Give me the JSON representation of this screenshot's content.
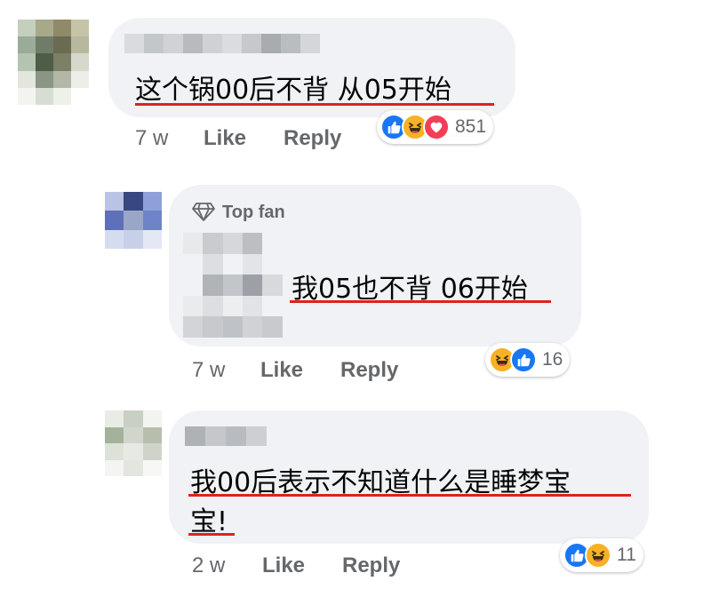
{
  "comments": [
    {
      "text": "这个锅00后不背 从05开始",
      "time": "7 w",
      "like_label": "Like",
      "reply_label": "Reply",
      "reaction_count": "851",
      "reactions": [
        "like-icon",
        "haha-icon",
        "love-icon"
      ]
    },
    {
      "badge": "Top fan",
      "text": "我05也不背 06开始",
      "time": "7 w",
      "like_label": "Like",
      "reply_label": "Reply",
      "reaction_count": "16",
      "reactions": [
        "haha-icon",
        "like-icon"
      ]
    },
    {
      "text_line1": "我00后表示不知道什么是睡梦宝",
      "text_line2": "宝!",
      "time": "2 w",
      "like_label": "Like",
      "reply_label": "Reply",
      "reaction_count": "11",
      "reactions": [
        "like-icon",
        "haha-icon"
      ]
    }
  ],
  "colors": {
    "bubble": "#f0f2f5",
    "underline": "#e0211d",
    "meta": "#65676b",
    "like": "#1877f2",
    "haha": "#f7b125",
    "love": "#f33e58"
  }
}
